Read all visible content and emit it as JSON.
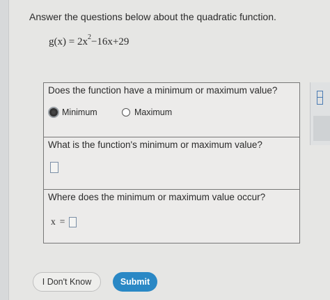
{
  "prompt": "Answer the questions below about the quadratic function.",
  "function": {
    "lhs": "g(x)",
    "eq": "=",
    "coef_a": "2x",
    "exp": "2",
    "rest": "−16x+29"
  },
  "q1": {
    "text": "Does the function have a minimum or maximum value?",
    "options": [
      "Minimum",
      "Maximum"
    ],
    "selected": "Minimum"
  },
  "q2": {
    "text": "What is the function's minimum or maximum value?",
    "value": ""
  },
  "q3": {
    "text": "Where does the minimum or maximum value occur?",
    "var_label": "x",
    "eq": "=",
    "value": ""
  },
  "buttons": {
    "idk": "I Don't Know",
    "submit": "Submit"
  },
  "colors": {
    "submit_bg": "#2a88c5",
    "input_border": "#7a8ea6"
  }
}
